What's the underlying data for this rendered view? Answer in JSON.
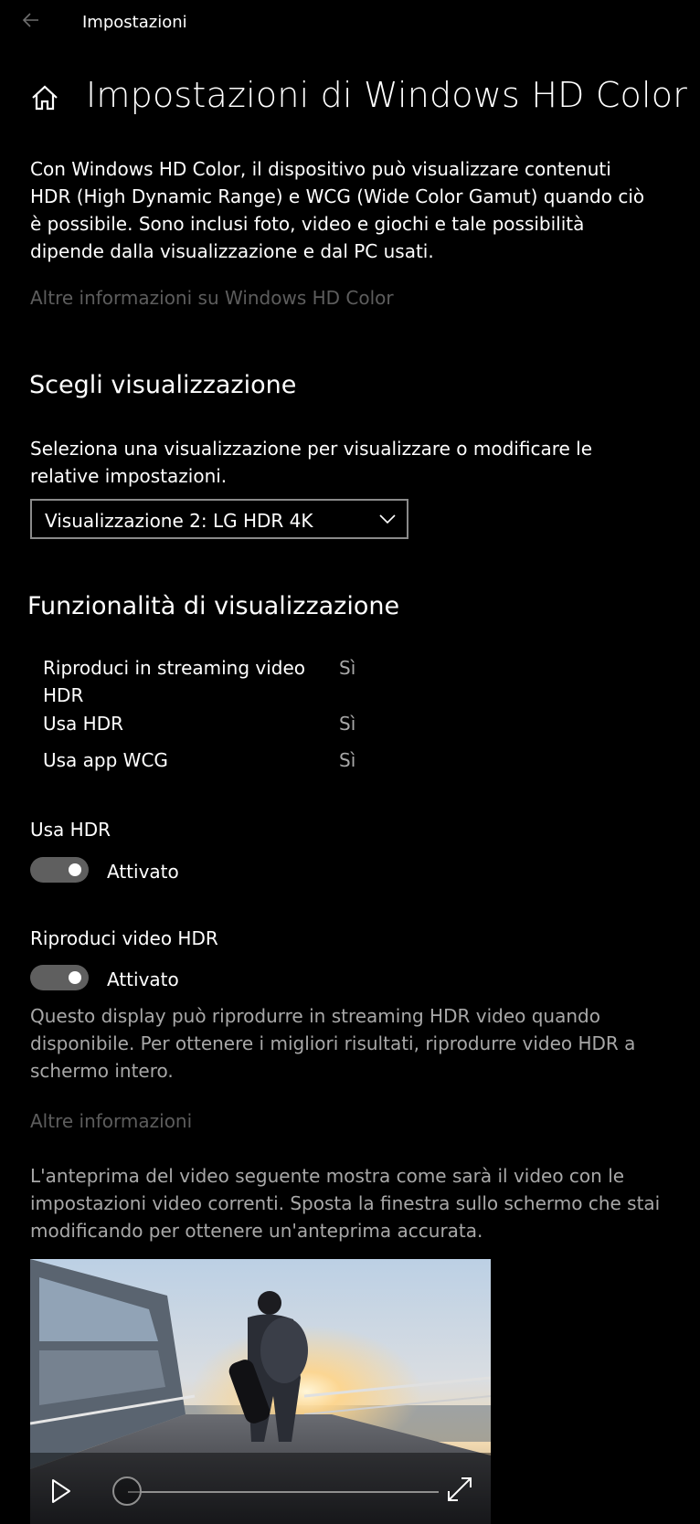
{
  "titlebar": {
    "title": "Impostazioni"
  },
  "page": {
    "title": "Impostazioni di Windows HD Color"
  },
  "intro": {
    "text": "Con Windows HD Color, il dispositivo può visualizzare contenuti HDR (High Dynamic Range) e WCG (Wide Color Gamut) quando ciò è possibile. Sono inclusi foto, video e giochi e tale possibilità dipende dalla visualizzazione e dal PC usati.",
    "link": "Altre informazioni su Windows HD Color"
  },
  "choose_display": {
    "title": "Scegli visualizzazione",
    "description": "Seleziona una visualizzazione per visualizzare o modificare le relative impostazioni.",
    "selected": "Visualizzazione 2: LG HDR 4K"
  },
  "capabilities": {
    "title": "Funzionalità di visualizzazione",
    "rows": [
      {
        "label": "Riproduci in streaming video HDR",
        "value": "Sì"
      },
      {
        "label": "Usa HDR",
        "value": "Sì"
      },
      {
        "label": "Usa app WCG",
        "value": "Sì"
      }
    ]
  },
  "use_hdr": {
    "label": "Usa HDR",
    "state": "Attivato"
  },
  "play_hdr_video": {
    "label": "Riproduci video HDR",
    "state": "Attivato",
    "description": "Questo display può riprodurre in streaming HDR video quando disponibile. Per ottenere i migliori risultati, riprodurre video HDR a schermo intero.",
    "link": "Altre informazioni"
  },
  "preview": {
    "description": "L'anteprima del video seguente mostra come sarà il video con le impostazioni video correnti. Sposta la finestra sullo schermo che stai modificando per ottenere un'anteprima accurata."
  },
  "colors": {
    "background": "#000000",
    "toggle_on": "#5f5f5f",
    "disabled_link": "#5d5d5d"
  }
}
